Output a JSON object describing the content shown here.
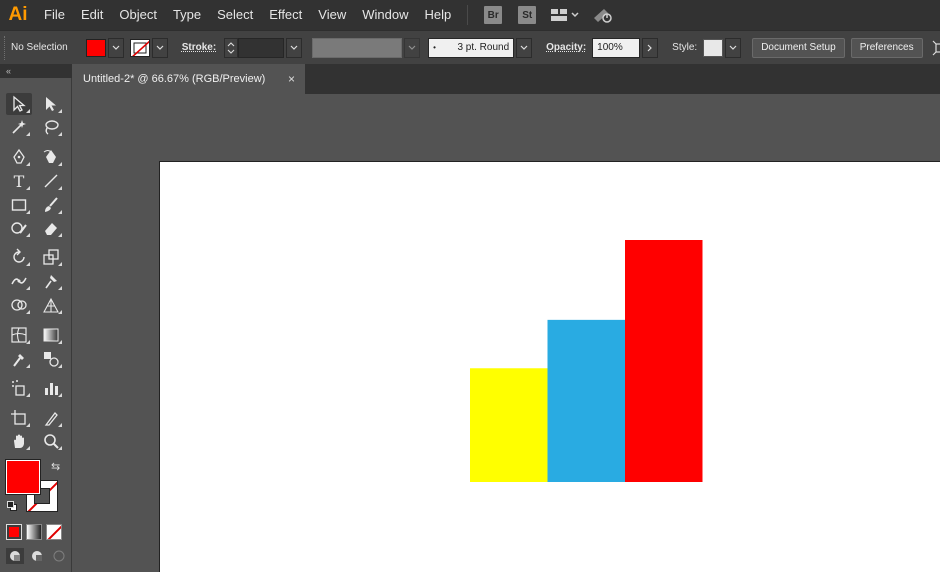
{
  "app": {
    "logo": "Ai",
    "menu": [
      "File",
      "Edit",
      "Object",
      "Type",
      "Select",
      "Effect",
      "View",
      "Window",
      "Help"
    ],
    "badges": [
      "Br",
      "St"
    ]
  },
  "control_bar": {
    "selection": "No Selection",
    "stroke_label": "Stroke:",
    "stroke_weight": "",
    "brush": "3 pt. Round",
    "opacity_label": "Opacity:",
    "opacity_value": "100%",
    "style_label": "Style:",
    "document_setup": "Document Setup",
    "preferences": "Preferences"
  },
  "colors": {
    "fill": "#ff0000",
    "stroke": "none"
  },
  "document": {
    "tab_title": "Untitled-2* @ 66.67% (RGB/Preview)",
    "close_glyph": "×"
  },
  "tools": [
    [
      "selection-tool",
      "direct-selection-tool"
    ],
    [
      "magic-wand-tool",
      "lasso-tool"
    ],
    [
      "pen-tool",
      "curvature-tool"
    ],
    [
      "type-tool",
      "line-segment-tool"
    ],
    [
      "rectangle-tool",
      "paintbrush-tool"
    ],
    [
      "shaper-tool",
      "eraser-tool"
    ],
    [
      "rotate-tool",
      "scale-tool"
    ],
    [
      "width-tool",
      "puppet-warp-tool"
    ],
    [
      "shape-builder-tool",
      "perspective-grid-tool"
    ],
    [
      "mesh-tool",
      "gradient-tool"
    ],
    [
      "eyedropper-tool",
      "blend-tool"
    ],
    [
      "symbol-sprayer-tool",
      "column-graph-tool"
    ],
    [
      "artboard-tool",
      "slice-tool"
    ],
    [
      "hand-tool",
      "zoom-tool"
    ]
  ],
  "chart_data": {
    "type": "bar",
    "categories": [
      "",
      "",
      ""
    ],
    "values": [
      47,
      67,
      100
    ],
    "colors": [
      "#ffff00",
      "#29abe2",
      "#ff0000"
    ],
    "ylim": [
      0,
      100
    ]
  }
}
